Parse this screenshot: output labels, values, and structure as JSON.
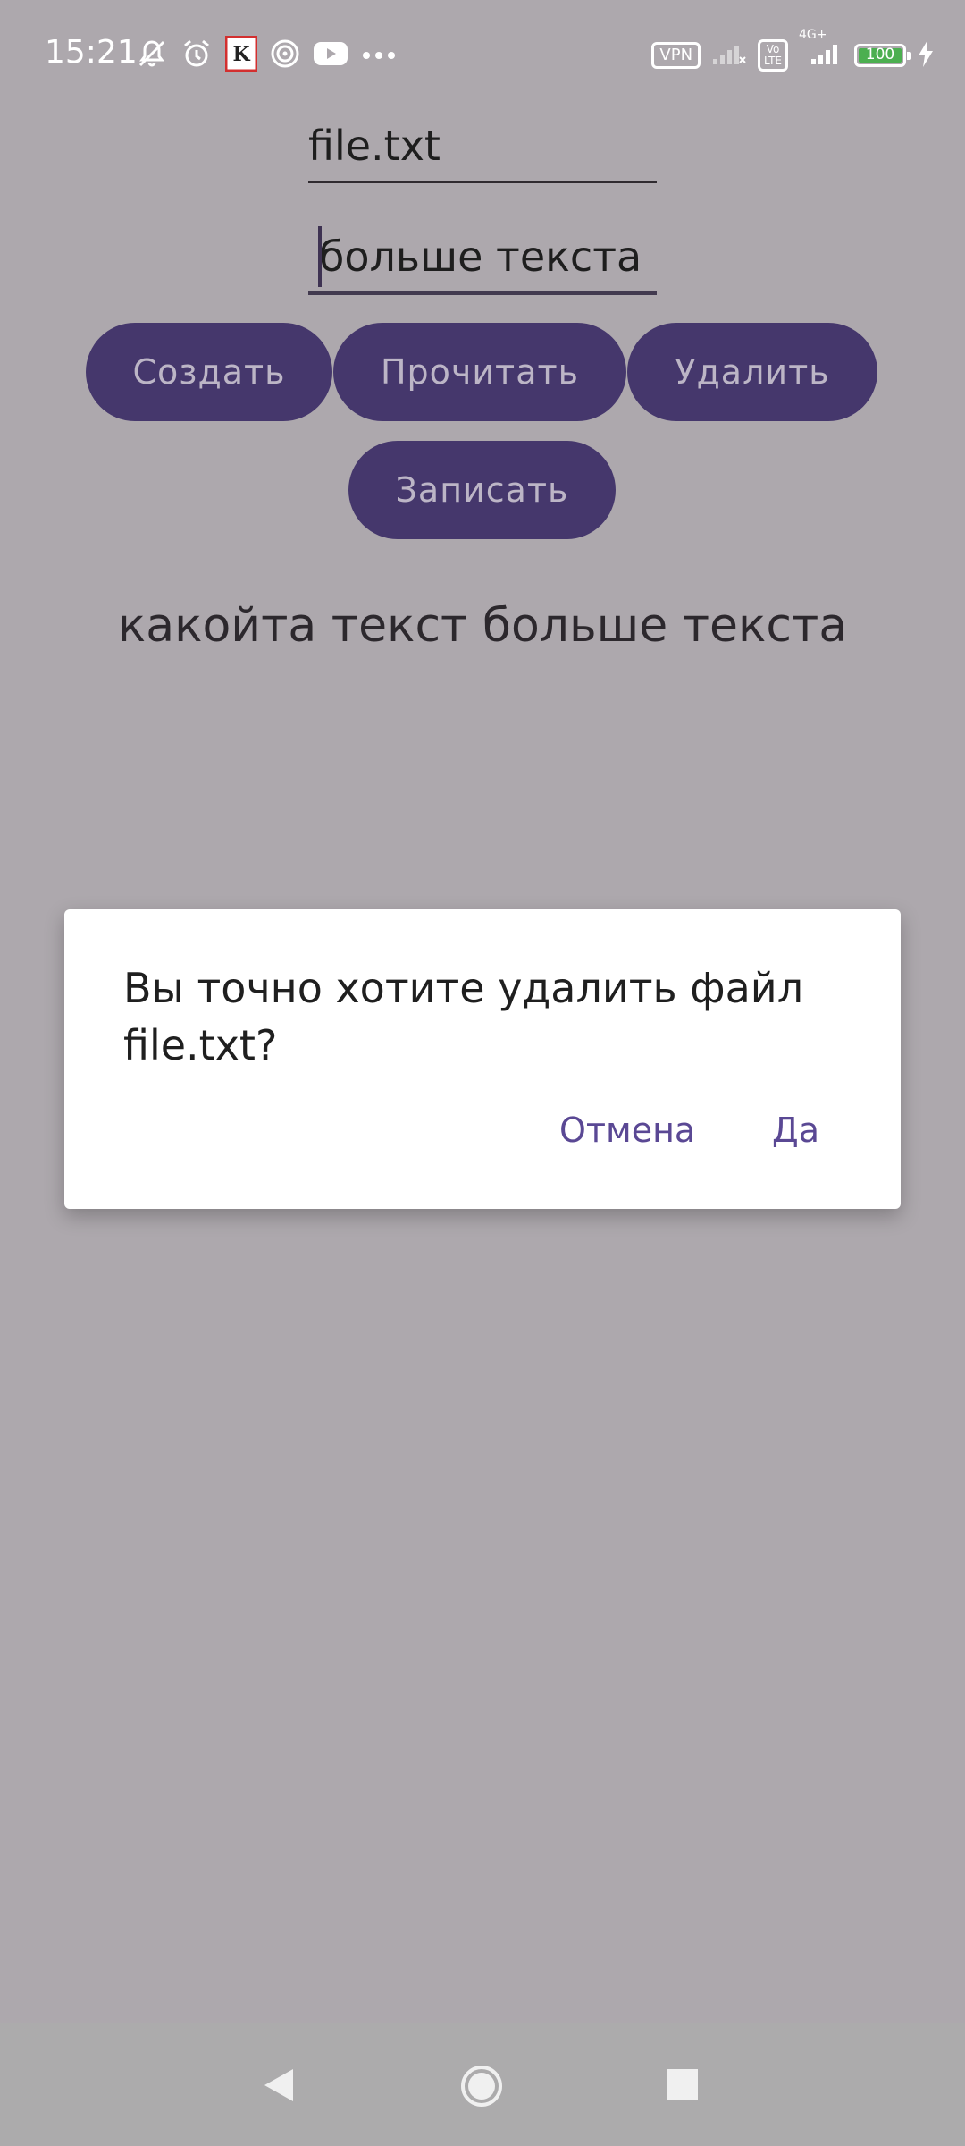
{
  "status_bar": {
    "time": "15:21",
    "vpn_label": "VPN",
    "volte_label": "Vo\nLTE",
    "network_label": "4G+",
    "battery_level": "100",
    "icons": [
      "bell-off-icon",
      "alarm-icon",
      "app-k-icon",
      "spiral-icon",
      "youtube-icon",
      "more-dots-icon",
      "signal-icon",
      "charging-icon"
    ]
  },
  "form": {
    "filename_value": "file.txt",
    "text_value": "больше текста"
  },
  "buttons": {
    "create": "Создать",
    "read": "Прочитать",
    "delete": "Удалить",
    "write": "Записать"
  },
  "result_text": "какойта текст больше текста",
  "dialog": {
    "message": "Вы точно хотите удалить файл file.txt?",
    "cancel": "Отмена",
    "confirm": "Да"
  },
  "colors": {
    "scrim_background": "#ada8ad",
    "button": "#45376c",
    "button_text": "#bcb5c6",
    "dialog_action": "#5a4894"
  }
}
